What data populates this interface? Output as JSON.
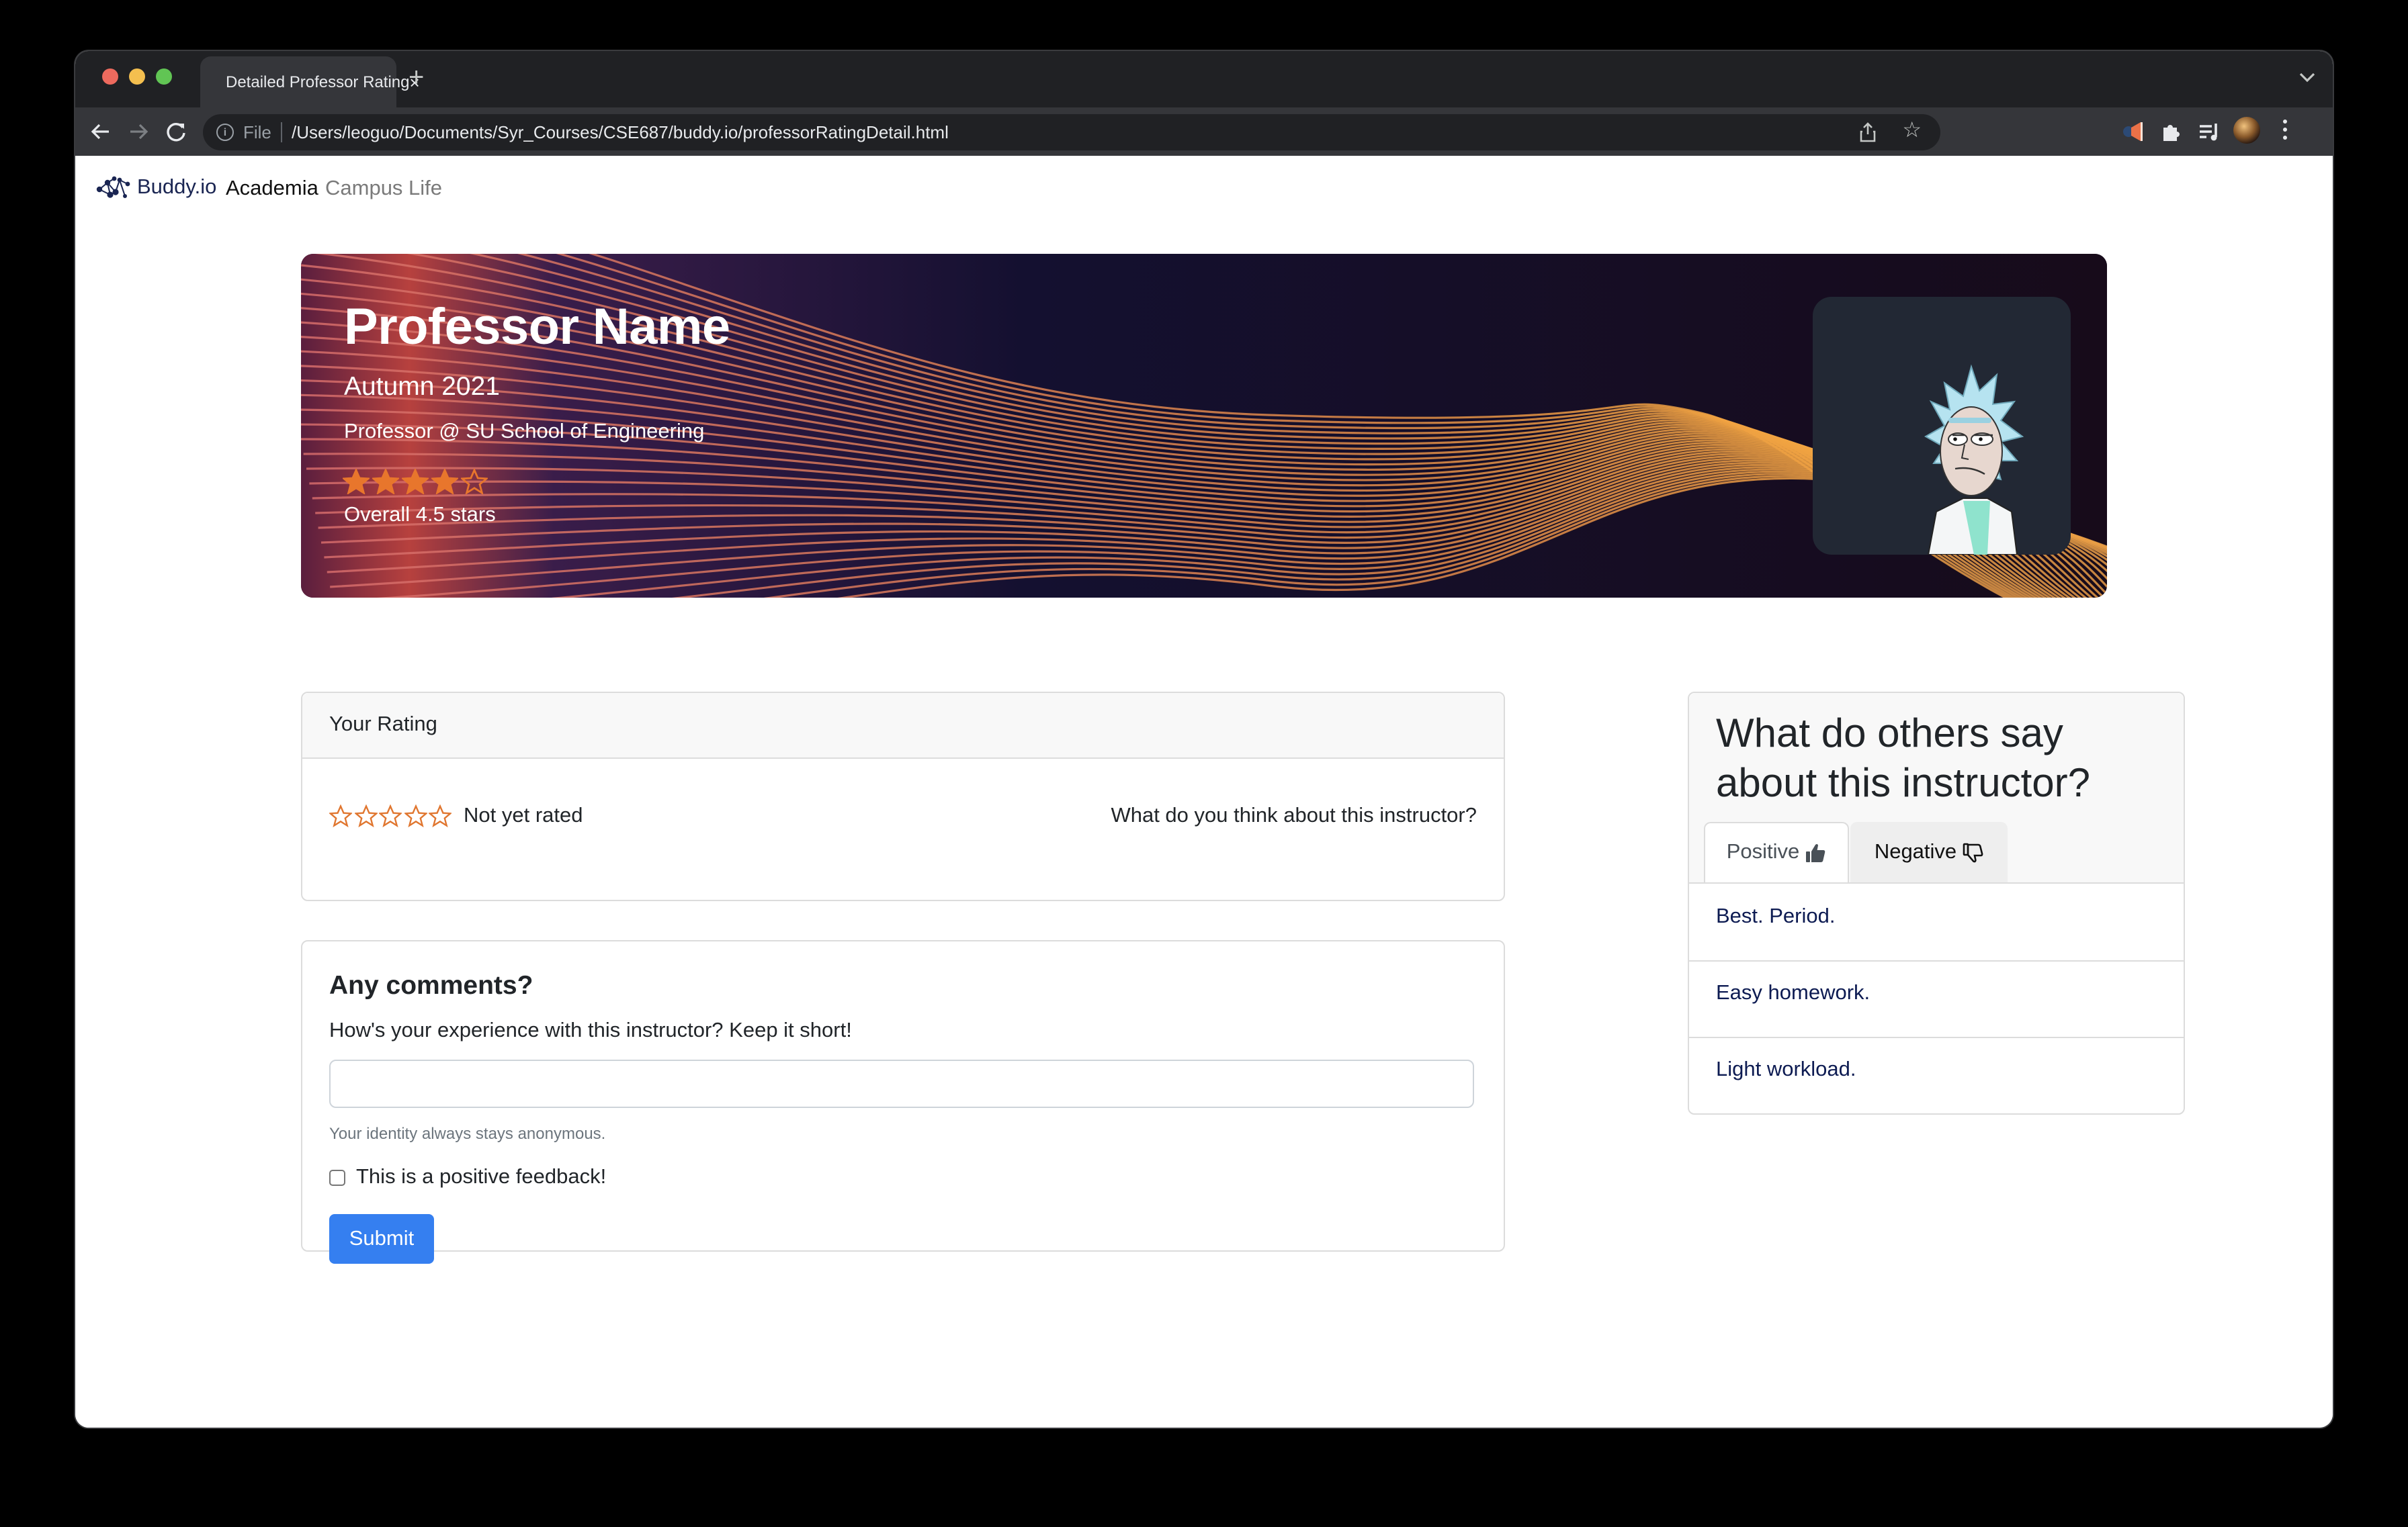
{
  "browser": {
    "tab_title": "Detailed Professor Rating",
    "tab_close": "×",
    "new_tab": "+",
    "omnibox_scheme_label": "File",
    "omnibox_url": "/Users/leoguo/Documents/Syr_Courses/CSE687/buddy.io/professorRatingDetail.html",
    "omnibox_info": "i",
    "star": "☆"
  },
  "navbar": {
    "brand": "Buddy.io",
    "links": [
      {
        "label": "Academia",
        "active": true
      },
      {
        "label": "Campus Life",
        "active": false
      }
    ]
  },
  "hero": {
    "name": "Professor Name",
    "term": "Autumn 2021",
    "department": "Professor @ SU School of Engineering",
    "star_rating": {
      "filled": 4,
      "total": 5
    },
    "overall_label": "Overall 4.5 stars",
    "star_color": "#e8762c"
  },
  "your_rating": {
    "header": "Your Rating",
    "stars": {
      "filled": 0,
      "total": 5
    },
    "status": "Not yet rated",
    "prompt": "What do you think about this instructor?",
    "star_color": "#e0762f"
  },
  "comments": {
    "title": "Any comments?",
    "label": "How's your experience with this instructor? Keep it short!",
    "input_value": "",
    "input_placeholder": "",
    "help_text": "Your identity always stays anonymous.",
    "checkbox_label": "This is a positive feedback!",
    "checkbox_checked": false,
    "submit_label": "Submit",
    "submit_color": "#357ff0"
  },
  "others": {
    "title": "What do others say about this instructor?",
    "tabs": [
      {
        "label": "Positive",
        "icon": "thumbs-up-icon",
        "active": true
      },
      {
        "label": "Negative",
        "icon": "thumbs-down-icon",
        "active": false
      }
    ],
    "feedback": [
      "Best. Period.",
      "Easy homework.",
      "Light workload."
    ]
  }
}
